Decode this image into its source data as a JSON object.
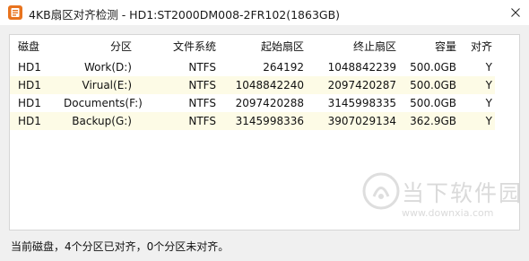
{
  "window": {
    "title": "4KB扇区对齐检测 - HD1:ST2000DM008-2FR102(1863GB)",
    "accent": "#e8731e"
  },
  "table": {
    "headers": {
      "disk": "磁盘",
      "partition": "分区",
      "fs": "文件系统",
      "start": "起始扇区",
      "end": "终止扇区",
      "capacity": "容量",
      "aligned": "对齐"
    },
    "rows": [
      {
        "disk": "HD1",
        "partition": "Work(D:)",
        "fs": "NTFS",
        "start": "264192",
        "end": "1048842239",
        "capacity": "500.0GB",
        "aligned": "Y"
      },
      {
        "disk": "HD1",
        "partition": "Virual(E:)",
        "fs": "NTFS",
        "start": "1048842240",
        "end": "2097420287",
        "capacity": "500.0GB",
        "aligned": "Y"
      },
      {
        "disk": "HD1",
        "partition": "Documents(F:)",
        "fs": "NTFS",
        "start": "2097420288",
        "end": "3145998335",
        "capacity": "500.0GB",
        "aligned": "Y"
      },
      {
        "disk": "HD1",
        "partition": "Backup(G:)",
        "fs": "NTFS",
        "start": "3145998336",
        "end": "3907029134",
        "capacity": "362.9GB",
        "aligned": "Y"
      }
    ],
    "stripe_color": "#fdfbe6"
  },
  "status": {
    "text": "当前磁盘，4个分区已对齐，0个分区未对齐。"
  },
  "watermark": {
    "name": "当下软件园",
    "url": "www.downxia.com"
  }
}
